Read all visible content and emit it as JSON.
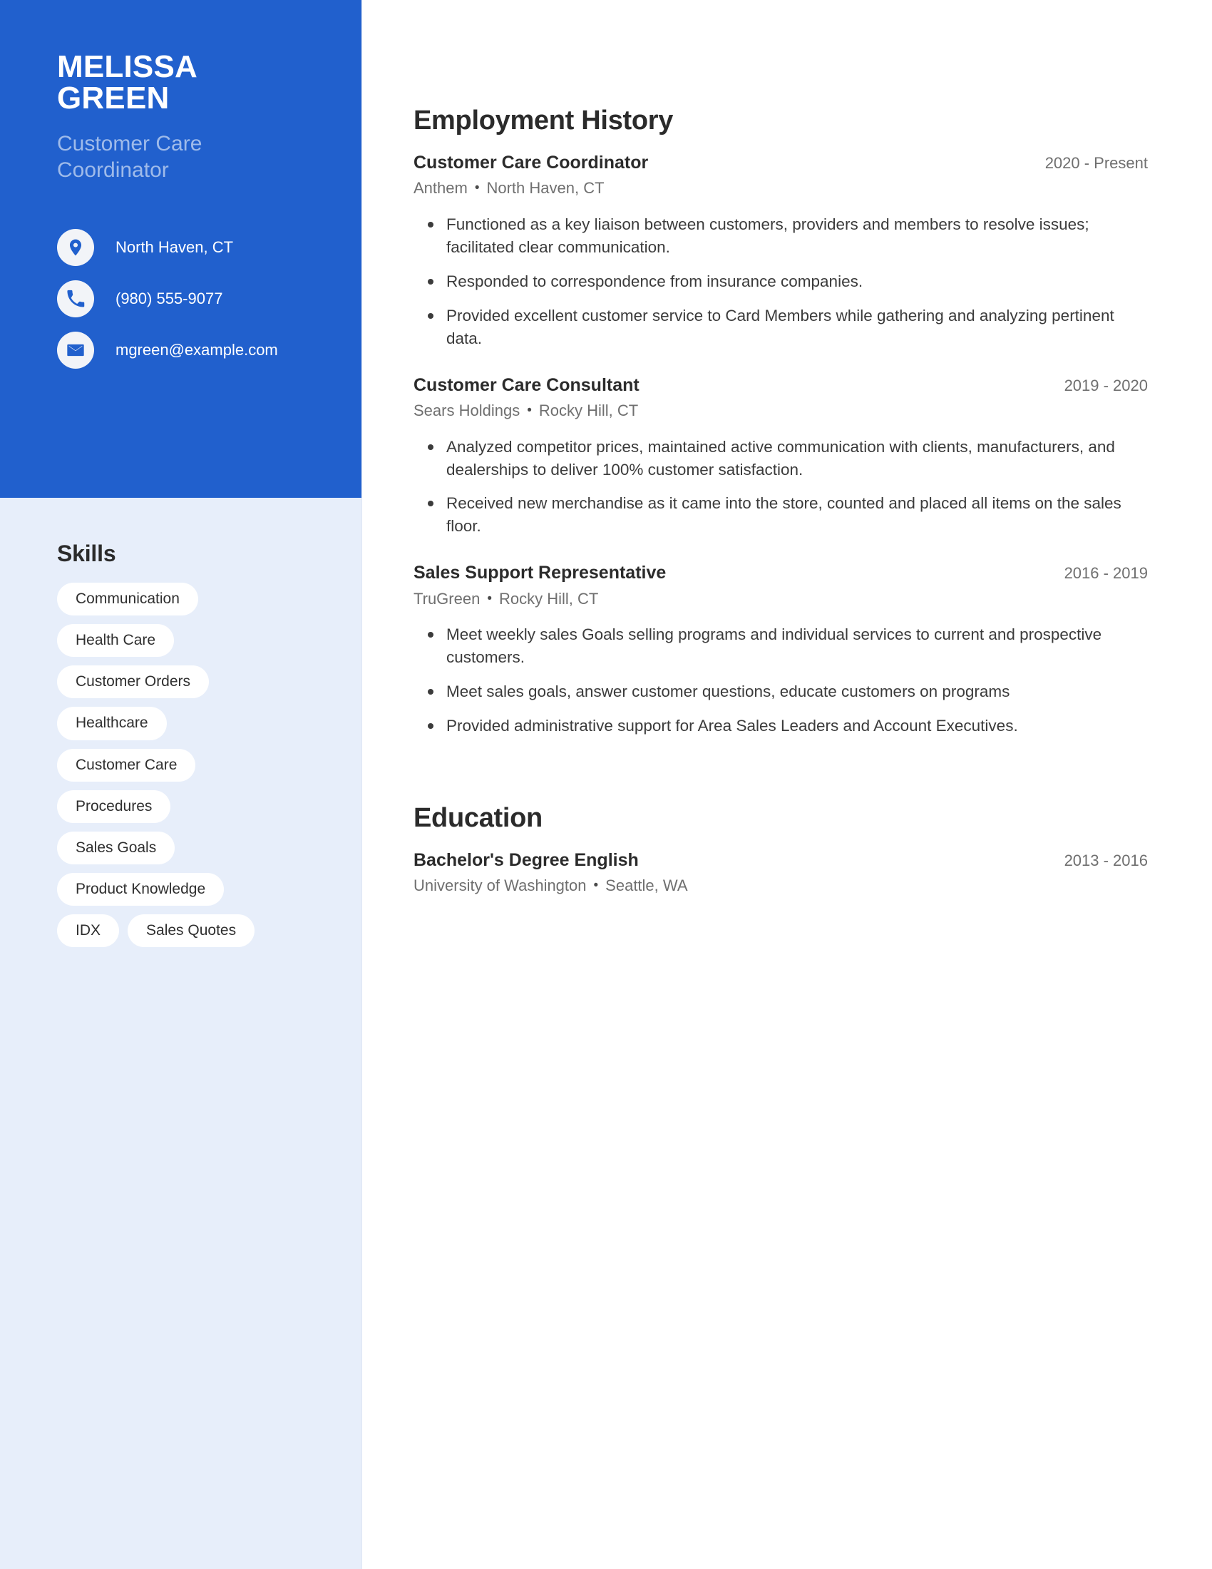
{
  "profile": {
    "first_name": "MELISSA",
    "last_name": "GREEN",
    "job_title": "Customer Care Coordinator",
    "contacts": [
      {
        "icon": "location-pin-icon",
        "value": "North Haven, CT"
      },
      {
        "icon": "phone-icon",
        "value": "(980) 555-9077"
      },
      {
        "icon": "envelope-icon",
        "value": "mgreen@example.com"
      }
    ]
  },
  "colors": {
    "accent_blue": "#2160cd",
    "sidebar_bg": "#e7eefa",
    "tag_bg": "#ffffff",
    "subtitle": "#9fbbea",
    "heading": "#2b2b2b",
    "body_text": "#3b3b3b",
    "muted_text": "#6f6f6f"
  },
  "skills": {
    "heading": "Skills",
    "items": [
      "Communication",
      "Health Care",
      "Customer Orders",
      "Healthcare",
      "Customer Care",
      "Procedures",
      "Sales Goals",
      "Product Knowledge",
      "IDX",
      "Sales Quotes"
    ]
  },
  "employment": {
    "heading": "Employment History",
    "entries": [
      {
        "role": "Customer Care Coordinator",
        "dates": "2020 - Present",
        "company": "Anthem",
        "separator": "•",
        "location": "North Haven, CT",
        "bullets": [
          "Functioned as a key liaison between customers, providers and members to resolve issues; facilitated clear communication.",
          "Responded to correspondence from insurance companies.",
          "Provided excellent customer service to Card Members while gathering and analyzing pertinent data."
        ]
      },
      {
        "role": "Customer Care Consultant",
        "dates": "2019 - 2020",
        "company": "Sears Holdings",
        "separator": "•",
        "location": "Rocky Hill, CT",
        "bullets": [
          "Analyzed competitor prices, maintained active communication with clients, manufacturers, and dealerships to deliver 100% customer satisfaction.",
          "Received new merchandise as it came into the store, counted and placed all items on the sales floor."
        ]
      },
      {
        "role": "Sales Support Representative",
        "dates": "2016 - 2019",
        "company": "TruGreen",
        "separator": "•",
        "location": "Rocky Hill, CT",
        "bullets": [
          "Meet weekly sales Goals selling programs and individual services to current and prospective customers.",
          "Meet sales goals, answer customer questions, educate customers on programs",
          "Provided administrative support for Area Sales Leaders and Account Executives."
        ]
      }
    ]
  },
  "education": {
    "heading": "Education",
    "entries": [
      {
        "degree": "Bachelor's Degree English",
        "dates": "2013 - 2016",
        "school": "University of Washington",
        "separator": "•",
        "location": "Seattle, WA"
      }
    ]
  }
}
